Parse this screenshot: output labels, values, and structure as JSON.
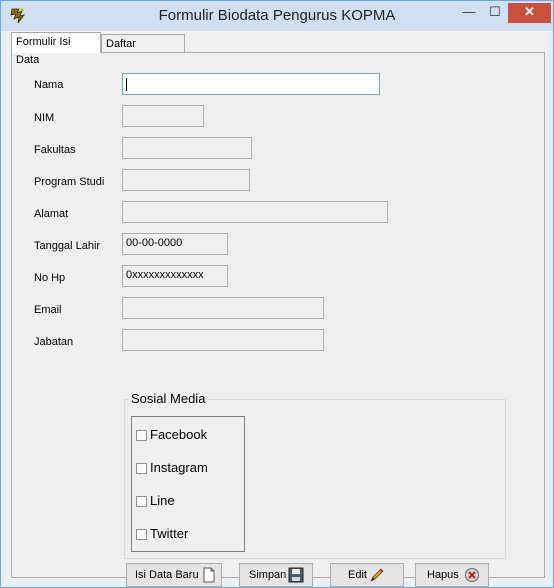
{
  "window": {
    "title": "Formulir Biodata Pengurus KOPMA",
    "minimize": "—",
    "maximize": "☐",
    "close": "✕"
  },
  "tabs": [
    {
      "label": "Formulir Isi Data"
    },
    {
      "label": "Daftar Pengurus"
    }
  ],
  "form": {
    "nama": {
      "label": "Nama",
      "value": ""
    },
    "nim": {
      "label": "NIM",
      "value": ""
    },
    "fakultas": {
      "label": "Fakultas",
      "value": ""
    },
    "program_studi": {
      "label": "Program Studi",
      "value": ""
    },
    "alamat": {
      "label": "Alamat",
      "value": ""
    },
    "tanggal_lahir": {
      "label": "Tanggal Lahir",
      "value": "00-00-0000"
    },
    "no_hp": {
      "label": "No Hp",
      "value": "0xxxxxxxxxxxxx"
    },
    "email": {
      "label": "Email",
      "value": ""
    },
    "jabatan": {
      "label": "Jabatan",
      "value": ""
    }
  },
  "sosial_media": {
    "title": "Sosial Media",
    "items": [
      {
        "label": "Facebook"
      },
      {
        "label": "Instagram"
      },
      {
        "label": "Line"
      },
      {
        "label": "Twitter"
      }
    ]
  },
  "buttons": {
    "isi_data_baru": "Isi Data Baru",
    "simpan": "Simpan",
    "edit": "Edit",
    "hapus": "Hapus"
  }
}
